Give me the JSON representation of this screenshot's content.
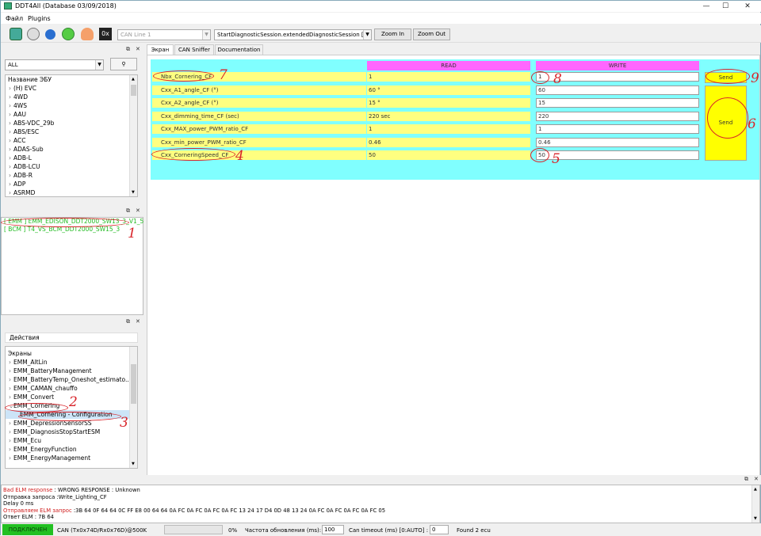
{
  "window": {
    "title": "DDT4All (Database 03/09/2018)",
    "minimize": "—",
    "maximize": "☐",
    "close": "✕"
  },
  "menu": [
    "Файл",
    "Plugins"
  ],
  "toolbar": {
    "can_line": "CAN Line 1",
    "session": "StartDiagnosticSession.extendedDiagnosticSession [10C0",
    "zoom_in": "Zoom In",
    "zoom_out": "Zoom Out",
    "hex_label": "0x",
    "icons": [
      "connect-icon",
      "gear-icon",
      "refresh-icon",
      "green-refresh-icon",
      "heartbeat-icon",
      "hex-icon"
    ]
  },
  "ecu_panel": {
    "filter": "ALL",
    "header": "Название ЭБУ",
    "items": [
      "(H) EVC",
      "4WD",
      "4WS",
      "AAU",
      "ABS-VDC_29b",
      "ABS/ESC",
      "ACC",
      "ADAS-Sub",
      "ADB-L",
      "ADB-LCU",
      "ADB-R",
      "ADP",
      "ASRMD"
    ]
  },
  "found_ecus": [
    "[ EMM ] EMM_EDISON_DDT2000_SW13_3_V1_5",
    "[ BCM ] T4_VS_BCM_DDT2000_SW15_3"
  ],
  "actions_panel": {
    "tab": "Действия",
    "header": "Экраны",
    "items": [
      {
        "label": "EMM_AltLin",
        "chev": "›"
      },
      {
        "label": "EMM_BatteryManagement",
        "chev": "›"
      },
      {
        "label": "EMM_BatteryTemp_Oneshot_estimato...",
        "chev": "›"
      },
      {
        "label": "EMM_CAMAN_chauffo",
        "chev": "›"
      },
      {
        "label": "EMM_Convert",
        "chev": "›"
      },
      {
        "label": "EMM_Cornering",
        "chev": "⌄"
      },
      {
        "label": "EMM_Cornering - Configuration",
        "chev": ""
      },
      {
        "label": "EMM_DepressionSensorSS",
        "chev": "›"
      },
      {
        "label": "EMM_DiagnosisStopStartESM",
        "chev": "›"
      },
      {
        "label": "EMM_Ecu",
        "chev": "›"
      },
      {
        "label": "EMM_EnergyFunction",
        "chev": "›"
      },
      {
        "label": "EMM_EnergyManagement",
        "chev": "›"
      }
    ]
  },
  "tabs": [
    "Экран",
    "CAN Sniffer",
    "Documentation"
  ],
  "screen": {
    "read_header": "READ",
    "write_header": "WRITE",
    "send_label": "Send",
    "rows": [
      {
        "label": "Nbx_Cornering_CF",
        "read": "1",
        "write": "1"
      },
      {
        "label": "Cxx_A1_angle_CF (°)",
        "read": "60 °",
        "write": "60"
      },
      {
        "label": "Cxx_A2_angle_CF (°)",
        "read": "15 °",
        "write": "15"
      },
      {
        "label": "Cxx_dimming_time_CF (sec)",
        "read": "220 sec",
        "write": "220"
      },
      {
        "label": "Cxx_MAX_power_PWM_ratio_CF",
        "read": "1",
        "write": "1"
      },
      {
        "label": "Cxx_min_power_PWM_ratio_CF",
        "read": "0.46",
        "write": "0.46"
      },
      {
        "label": "Cxx_CorneringSpeed_CF",
        "read": "50",
        "write": "50"
      }
    ]
  },
  "annotations": [
    "1",
    "2",
    "3",
    "4",
    "5",
    "6",
    "7",
    "8",
    "9"
  ],
  "log": [
    {
      "prefix": "Bad ELM response",
      "text": " : WRONG RESPONSE : Unknown",
      "color": "#d02020"
    },
    {
      "prefix": "Отправка запроса",
      "text": " :Write_Lighting_CF",
      "color": "#000"
    },
    {
      "prefix": "Delay 0 ms",
      "text": "",
      "color": "#000"
    },
    {
      "prefix": "Отправляем ELM запрос",
      "text": " :3B 64 0F 64 64 0C FF E8 00 64 64 0A FC 0A FC 0A FC 0A FC 13 24 17 D4 0D 48 13 24 0A FC 0A FC 0A FC 0A FC 05",
      "color": "#d02020"
    },
    {
      "prefix": "Ответ ELM",
      "text": " : 7B 64",
      "color": "#000"
    }
  ],
  "status": {
    "connected": "ПОДКЛЮЧЕН",
    "can": "CAN (Tx0x74D/Rx0x76D)@500K",
    "percent": "0%",
    "refresh_label": "Частота обновления (ms):",
    "refresh_value": "100",
    "timeout_label": "Can timeout (ms) [0:AUTO] :",
    "timeout_value": "0",
    "found": "Found 2 ecu"
  },
  "colors": {
    "screen_bg": "#80ffff",
    "header_pink": "#ff66ff",
    "label_yellow": "#ffff80",
    "send_yellow": "#ffff00",
    "annotation_red": "#d8242a",
    "found_green": "#22bb22",
    "status_green": "#22c022"
  }
}
